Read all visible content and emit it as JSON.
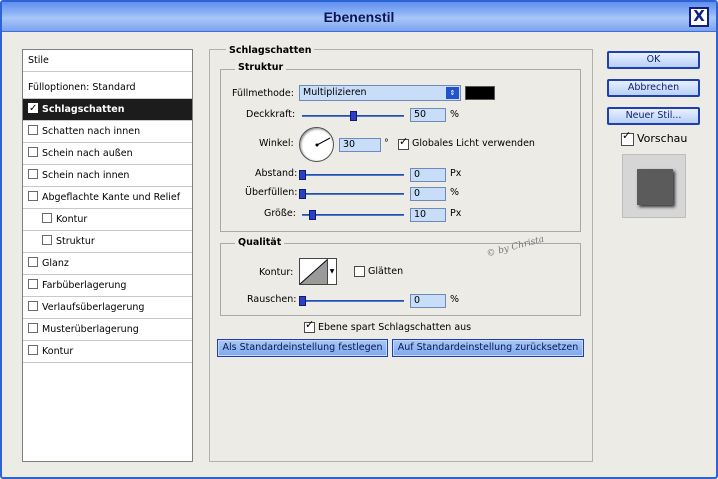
{
  "window": {
    "title": "Ebenenstil",
    "close_label": "X"
  },
  "styles_list": {
    "header": "Stile",
    "items": [
      {
        "label": "Fülloptionen: Standard",
        "checkbox": false,
        "checked": false,
        "selected": false
      },
      {
        "label": "Schlagschatten",
        "checkbox": true,
        "checked": true,
        "selected": true
      },
      {
        "label": "Schatten nach innen",
        "checkbox": true,
        "checked": false,
        "selected": false
      },
      {
        "label": "Schein nach außen",
        "checkbox": true,
        "checked": false,
        "selected": false
      },
      {
        "label": "Schein nach innen",
        "checkbox": true,
        "checked": false,
        "selected": false
      },
      {
        "label": "Abgeflachte Kante und Relief",
        "checkbox": true,
        "checked": false,
        "selected": false
      },
      {
        "label": "Kontur",
        "checkbox": true,
        "checked": false,
        "selected": false,
        "indent": true
      },
      {
        "label": "Struktur",
        "checkbox": true,
        "checked": false,
        "selected": false,
        "indent": true
      },
      {
        "label": "Glanz",
        "checkbox": true,
        "checked": false,
        "selected": false
      },
      {
        "label": "Farbüberlagerung",
        "checkbox": true,
        "checked": false,
        "selected": false
      },
      {
        "label": "Verlaufsüberlagerung",
        "checkbox": true,
        "checked": false,
        "selected": false
      },
      {
        "label": "Musterüberlagerung",
        "checkbox": true,
        "checked": false,
        "selected": false
      },
      {
        "label": "Kontur",
        "checkbox": true,
        "checked": false,
        "selected": false
      }
    ]
  },
  "drop_shadow": {
    "section_title": "Schlagschatten",
    "structure": {
      "title": "Struktur",
      "blend_mode_label": "Füllmethode:",
      "blend_mode_value": "Multiplizieren",
      "shadow_color": "#000000",
      "opacity_label": "Deckkraft:",
      "opacity_value": "50",
      "opacity_unit": "%",
      "opacity_fraction": 0.5,
      "angle_label": "Winkel:",
      "angle_value": "30",
      "angle_unit": "°",
      "global_light_label": "Globales Licht verwenden",
      "global_light_checked": true,
      "distance_label": "Abstand:",
      "distance_value": "0",
      "distance_unit": "Px",
      "spread_label": "Überfüllen:",
      "spread_value": "0",
      "spread_unit": "%",
      "size_label": "Größe:",
      "size_value": "10",
      "size_unit": "Px"
    },
    "quality": {
      "title": "Qualität",
      "contour_label": "Kontur:",
      "antialias_label": "Glätten",
      "antialias_checked": false,
      "noise_label": "Rauschen:",
      "noise_value": "0",
      "noise_unit": "%"
    },
    "knockout_label": "Ebene spart Schlagschatten aus",
    "knockout_checked": true,
    "make_default_label": "Als Standardeinstellung festlegen",
    "reset_default_label": "Auf Standardeinstellung zurücksetzen"
  },
  "buttons": {
    "ok": "OK",
    "cancel": "Abbrechen",
    "new_style": "Neuer Stil...",
    "preview_label": "Vorschau",
    "preview_checked": true
  },
  "watermark": "© by Christa",
  "colors": {
    "accent": "#2353c9",
    "title_bar": "#7aa3f0",
    "selected_row": "#1c1c1c",
    "field": "#c7ddf8"
  }
}
